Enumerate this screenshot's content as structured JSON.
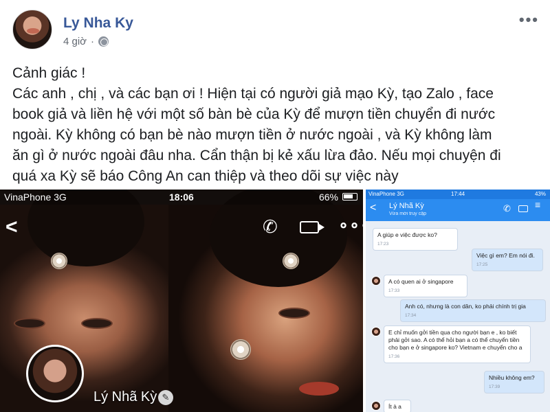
{
  "post": {
    "author": "Ly Nha Ky",
    "time": "4 giờ",
    "privacy_icon": "globe-icon",
    "more_icon": "more-options-icon",
    "text_lines": [
      "Cảnh giác !",
      "Các anh , chị , và các bạn ơi ! Hiện tại có người giả mạo Kỳ, tạo Zalo , face",
      "book giả và liền hệ với một số bàn bè của Kỳ để mượn tiền chuyển đi nước",
      "ngoài. Kỳ không có bạn bè nào mượn tiền ở nước ngoài , và Kỳ không làm",
      "ăn gì ở nước ngoài đâu nha. Cẩn thận bị kẻ xấu lừa đảo. Nếu mọi chuyện đi",
      "quá xa Kỳ sẽ báo Công An can thiệp và theo dõi sự việc này"
    ]
  },
  "phone_screenshot": {
    "carrier": "VinaPhone  3G",
    "time": "18:06",
    "battery": "66%",
    "profile_name": "Lý Nhã Kỳ",
    "icons": [
      "back-icon",
      "phone-call-icon",
      "video-call-icon",
      "more-dots-icon",
      "edit-icon"
    ]
  },
  "chat_screenshot": {
    "carrier": "VinaPhone  3G",
    "time": "17:44",
    "battery": "43%",
    "contact_name": "Lý Nhã Kỳ",
    "contact_status": "Vừa mới truy cập",
    "messages": [
      {
        "dir": "in",
        "text": "A giúp e việc được ko?",
        "time": "17:23"
      },
      {
        "dir": "out",
        "text": "Việc gì em? Em nói đi.",
        "time": "17:25"
      },
      {
        "dir": "in",
        "text": "A có quen ai ở singapore",
        "time": "17:33"
      },
      {
        "dir": "out",
        "text": "Anh có, nhưng là con dân, ko phải chính trị gia",
        "time": "17:34"
      },
      {
        "dir": "in",
        "text": "E chỉ muốn gởi tiền qua cho người bạn e , ko biết phải gởi sao. A có thể hỏi bạn a có thể chuyển tiền cho bạn e ở singapore ko? Vietnam e chuyển cho a",
        "time": "17:36"
      },
      {
        "dir": "out",
        "text": "Nhiều không em?",
        "time": "17:39"
      },
      {
        "dir": "in",
        "text": "Ít à a",
        "time": ""
      }
    ]
  },
  "colors": {
    "author_link": "#385898",
    "meta_text": "#616770",
    "zalo_blue": "#2c8cf0",
    "chat_bg": "#e8eef6"
  }
}
